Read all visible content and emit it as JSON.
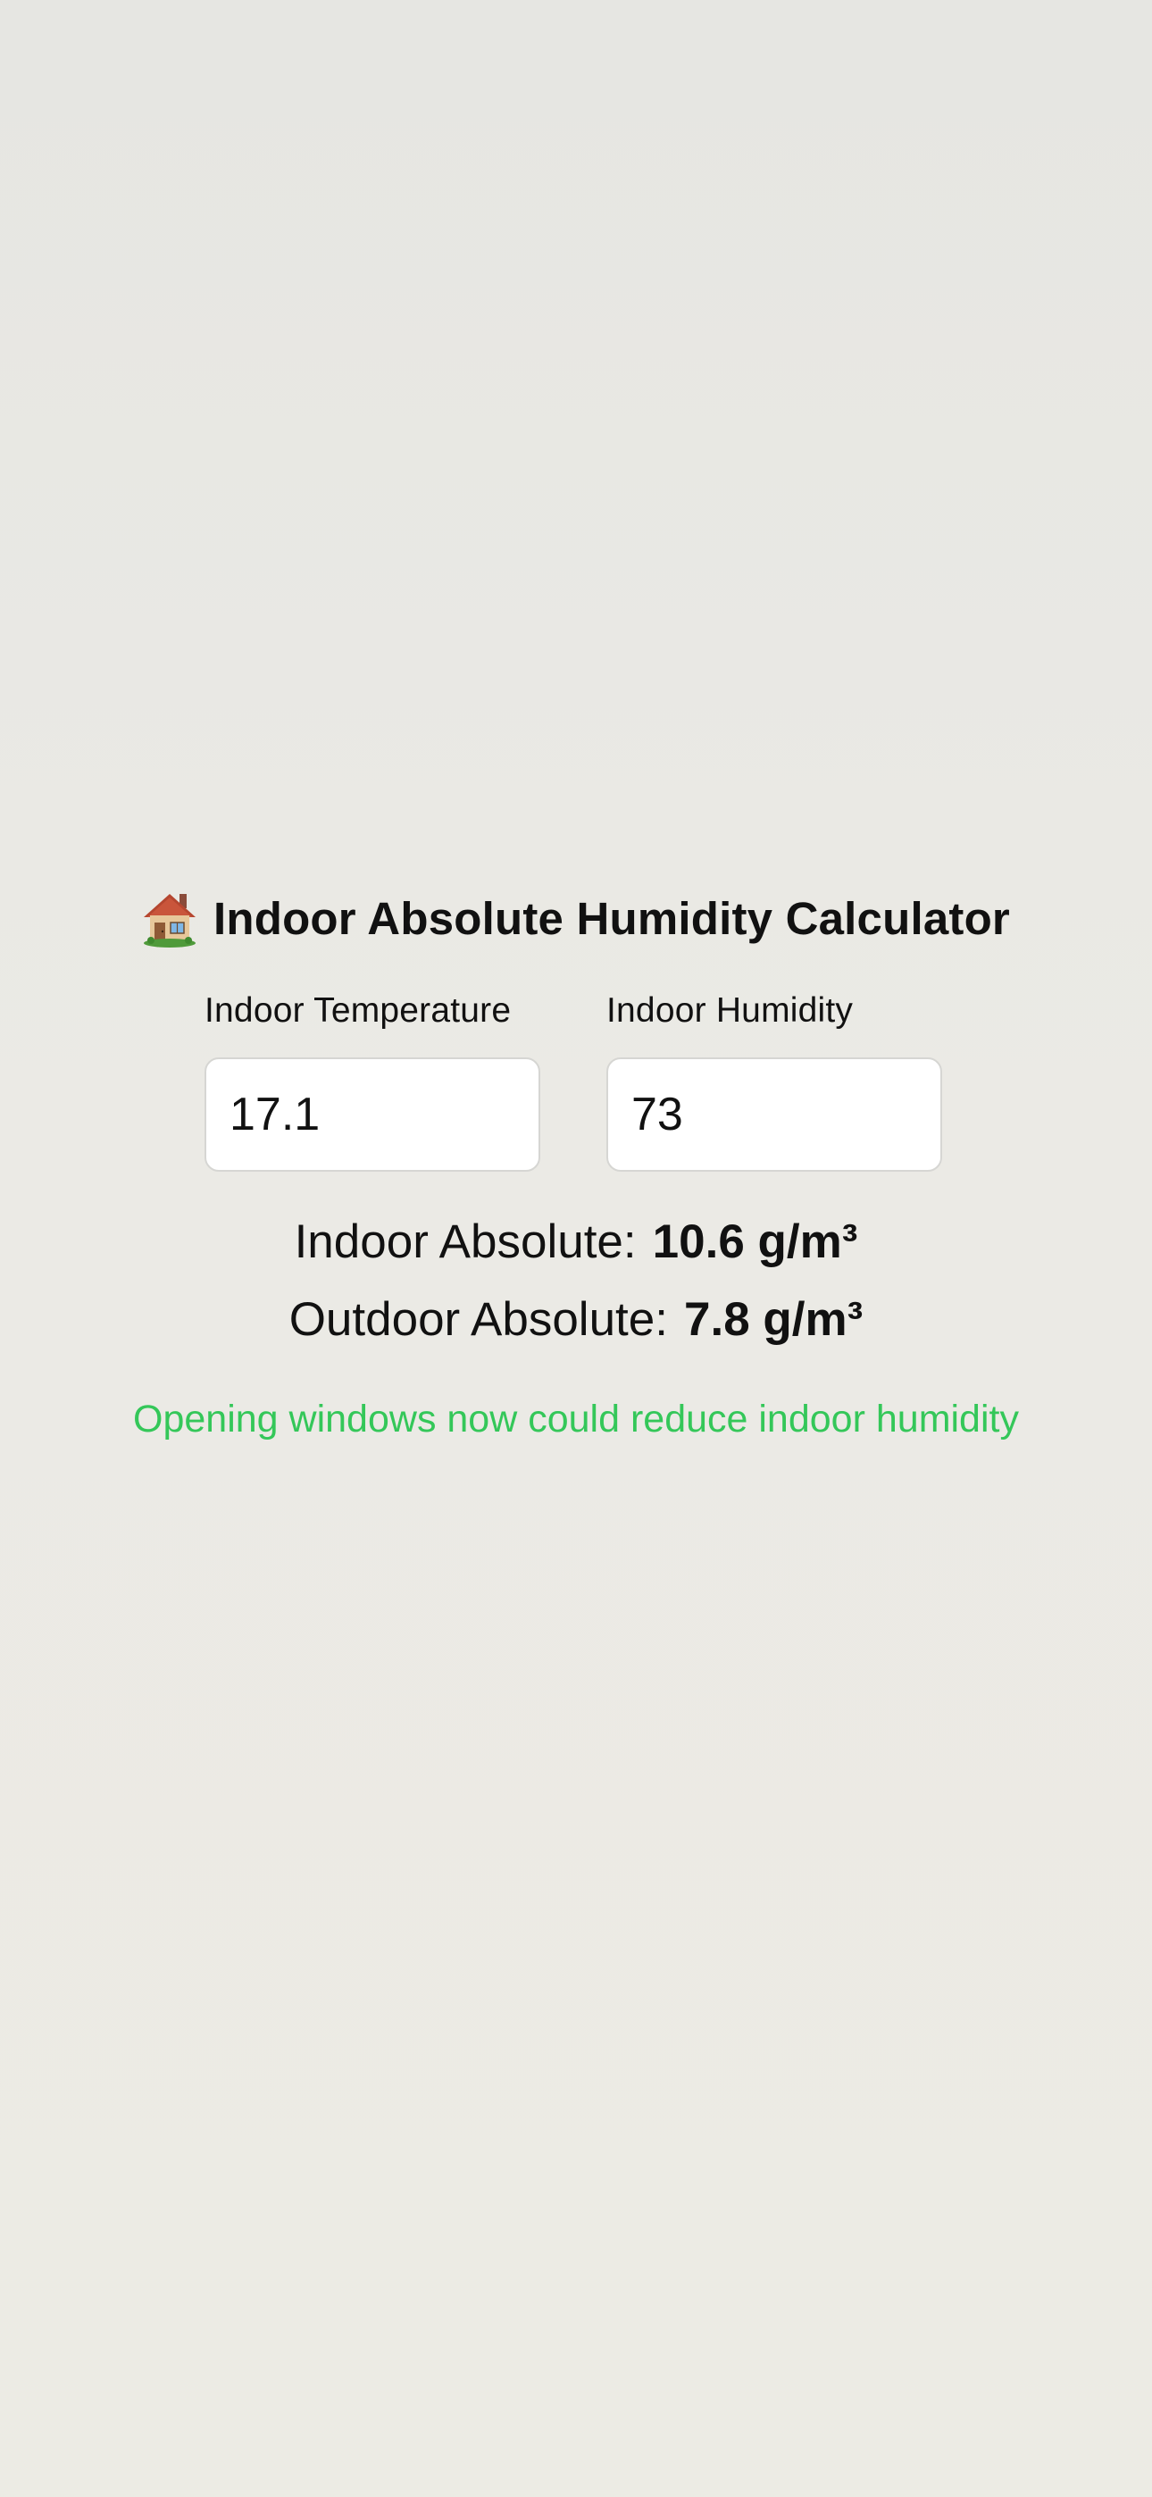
{
  "app": {
    "title": "Indoor Absolute Humidity Calculator",
    "title_icon": "house-icon"
  },
  "inputs": {
    "temperature": {
      "label": "Indoor Temperature",
      "value": "17.1"
    },
    "humidity": {
      "label": "Indoor Humidity",
      "value": "73"
    }
  },
  "results": {
    "indoor": {
      "label": "Indoor Absolute:",
      "value": "10.6 g/m³"
    },
    "outdoor": {
      "label": "Outdoor Absolute:",
      "value": "7.8 g/m³"
    }
  },
  "advice": {
    "text": "Opening windows now could reduce indoor humidity",
    "color": "#34c759"
  },
  "colors": {
    "background": "#e8e7e2",
    "input_background": "#ffffff",
    "text": "#111111"
  }
}
